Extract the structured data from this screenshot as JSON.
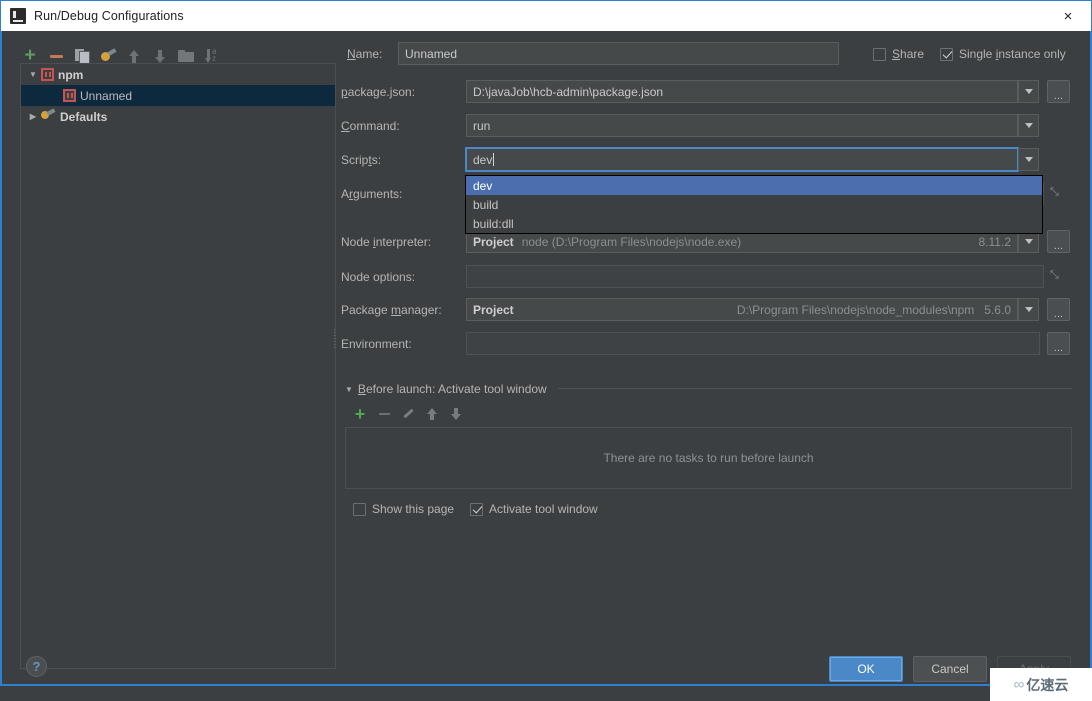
{
  "window": {
    "title": "Run/Debug Configurations",
    "app_icon": "intellij-idea-icon",
    "close_label": "×"
  },
  "left_toolbar": {
    "buttons": [
      {
        "name": "add-configuration-button",
        "icon": "plus-icon"
      },
      {
        "name": "remove-configuration-button",
        "icon": "minus-icon"
      },
      {
        "name": "copy-configuration-button",
        "icon": "copy-icon"
      },
      {
        "name": "edit-templates-button",
        "icon": "gear-config-icon"
      },
      {
        "name": "move-up-button",
        "icon": "arrow-up-icon"
      },
      {
        "name": "move-down-button",
        "icon": "arrow-down-icon"
      },
      {
        "name": "create-folder-button",
        "icon": "folder-icon"
      },
      {
        "name": "sort-configurations-button",
        "icon": "sort-alpha-icon"
      }
    ]
  },
  "tree": {
    "items": [
      {
        "label": "npm",
        "twisty": "▼",
        "icon": "npm-icon",
        "indent": 0,
        "selected": false,
        "bold": true
      },
      {
        "label": "Unnamed",
        "twisty": "",
        "icon": "npm-icon",
        "indent": 1,
        "selected": true,
        "bold": false
      },
      {
        "label": "Defaults",
        "twisty": "▶",
        "icon": "defaults-icon",
        "indent": 0,
        "selected": false,
        "bold": true
      }
    ]
  },
  "form": {
    "name_label": "Name:",
    "name_value": "Unnamed",
    "share_label": "Share",
    "share_checked": false,
    "single_instance_label": "Single instance only",
    "single_instance_checked": true,
    "package_json_label": "package.json:",
    "package_json_value": "D:\\javaJob\\hcb-admin\\package.json",
    "command_label": "Command:",
    "command_value": "run",
    "scripts_label": "Scripts:",
    "scripts_value": "dev",
    "arguments_label": "Arguments:",
    "arguments_value": "",
    "node_interpreter_label": "Node interpreter:",
    "node_interpreter_scope": "Project",
    "node_interpreter_value": "node (D:\\Program Files\\nodejs\\node.exe)",
    "node_interpreter_version": "8.11.2",
    "node_options_label": "Node options:",
    "node_options_value": "",
    "package_manager_label": "Package manager:",
    "package_manager_scope": "Project",
    "package_manager_value": "D:\\Program Files\\nodejs\\node_modules\\npm",
    "package_manager_version": "5.6.0",
    "environment_label": "Environment:",
    "environment_value": "",
    "browse_label": "..."
  },
  "scripts_dropdown": {
    "options": [
      {
        "label": "dev",
        "selected": true
      },
      {
        "label": "build",
        "selected": false
      },
      {
        "label": "build:dll",
        "selected": false
      }
    ]
  },
  "before_launch": {
    "header": "Before launch: Activate tool window",
    "twisty": "▼",
    "toolbar": [
      {
        "name": "add-task-button",
        "icon": "plus-icon"
      },
      {
        "name": "remove-task-button",
        "icon": "minus-icon"
      },
      {
        "name": "edit-task-button",
        "icon": "pencil-icon"
      },
      {
        "name": "move-task-up-button",
        "icon": "arrow-up-icon"
      },
      {
        "name": "move-task-down-button",
        "icon": "arrow-down-icon"
      }
    ],
    "empty_text": "There are no tasks to run before launch",
    "show_page_label": "Show this page",
    "show_page_checked": false,
    "activate_window_label": "Activate tool window",
    "activate_window_checked": true
  },
  "footer": {
    "help_label": "?",
    "ok_label": "OK",
    "cancel_label": "Cancel",
    "apply_label": "Apply",
    "apply_disabled": true
  },
  "watermark": {
    "logo": "∞",
    "text": "亿速云"
  },
  "colors": {
    "dialog_bg": "#3c3f41",
    "accent_border": "#2e7fd0",
    "field_bg": "#45494a",
    "selection_blue": "#4b6eaf",
    "tree_selection": "#0d293e",
    "primary_button": "#4a88c7",
    "npm_red": "#c75450",
    "plus_green": "#4fa84f"
  }
}
